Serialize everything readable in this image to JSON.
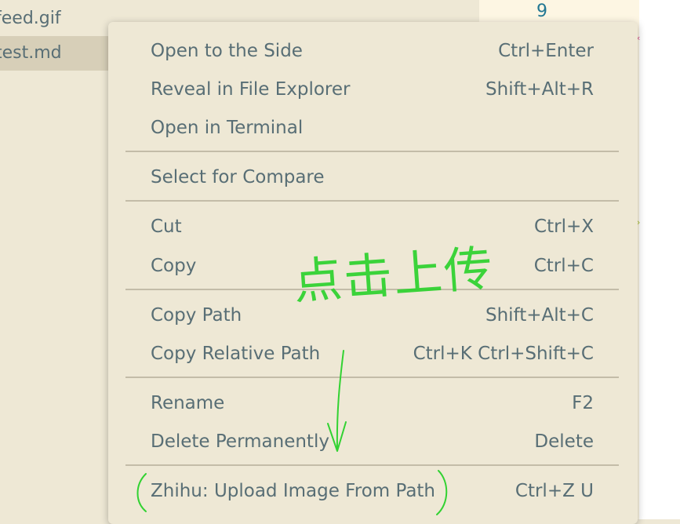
{
  "explorer": {
    "files": [
      {
        "name": "feed.gif",
        "selected": false
      },
      {
        "name": "test.md",
        "selected": true
      }
    ]
  },
  "editor": {
    "line_number": "9"
  },
  "context_menu": {
    "items": [
      {
        "label": "Open to the Side",
        "shortcut": "Ctrl+Enter"
      },
      {
        "label": "Reveal in File Explorer",
        "shortcut": "Shift+Alt+R"
      },
      {
        "label": "Open in Terminal",
        "shortcut": ""
      },
      {
        "label": "Select for Compare",
        "shortcut": ""
      },
      {
        "label": "Cut",
        "shortcut": "Ctrl+X"
      },
      {
        "label": "Copy",
        "shortcut": "Ctrl+C"
      },
      {
        "label": "Copy Path",
        "shortcut": "Shift+Alt+C"
      },
      {
        "label": "Copy Relative Path",
        "shortcut": "Ctrl+K Ctrl+Shift+C"
      },
      {
        "label": "Rename",
        "shortcut": "F2"
      },
      {
        "label": "Delete Permanently",
        "shortcut": "Delete"
      },
      {
        "label": "Zhihu: Upload Image From Path",
        "shortcut": "Ctrl+Z U"
      }
    ]
  },
  "annotation": {
    "text": "点击上传",
    "color": "#32d232"
  },
  "colors": {
    "menu_background": "#eee8d5",
    "menu_text": "#586e75",
    "separator": "#c3bca8",
    "selected_file": "#d7cfb8",
    "editor_background": "#fdf6e3",
    "line_number": "#237893",
    "annotation": "#32d232"
  }
}
